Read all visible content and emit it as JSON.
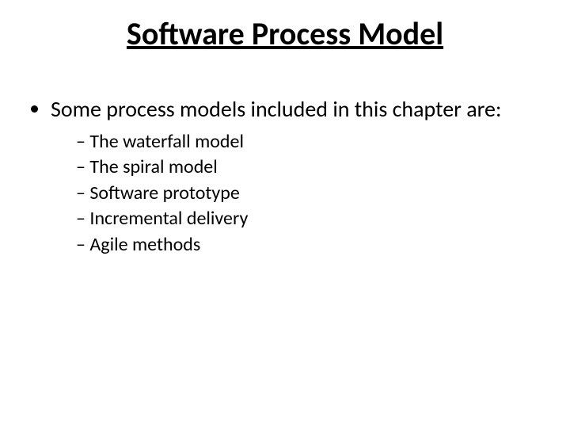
{
  "title": "Software Process Model",
  "intro": "Some process models included in this chapter are:",
  "items": [
    "The waterfall model",
    "The spiral  model",
    "Software prototype",
    "Incremental delivery",
    "Agile methods"
  ]
}
